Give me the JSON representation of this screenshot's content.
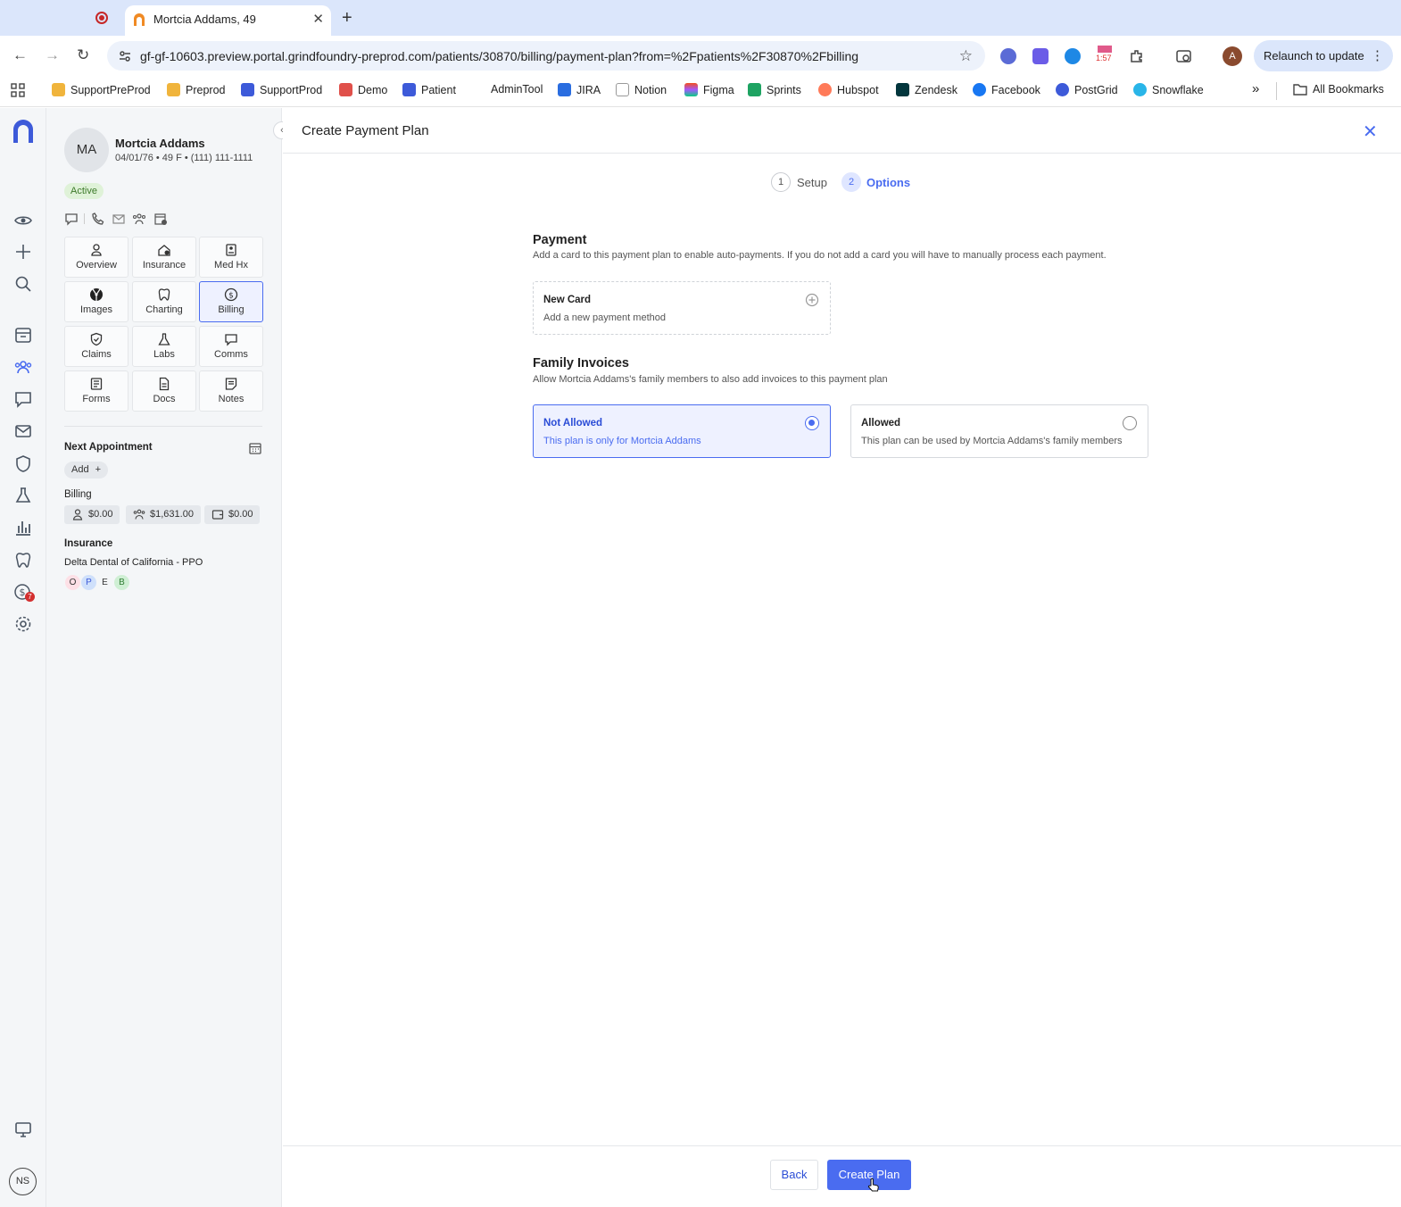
{
  "browser": {
    "tab_title": "Mortcia Addams, 49",
    "url": "gf-gf-10603.preview.portal.grindfoundry-preprod.com/patients/30870/billing/payment-plan?from=%2Fpatients%2F30870%2Fbilling",
    "relaunch_label": "Relaunch to update",
    "ext_badge": "1:57",
    "profile_initial": "A",
    "bookmarks": [
      "SupportPreProd",
      "Preprod",
      "SupportProd",
      "Demo",
      "Patient",
      "AdminTool",
      "JIRA",
      "Notion",
      "Figma",
      "Sprints",
      "Hubspot",
      "Zendesk",
      "Facebook",
      "PostGrid",
      "Snowflake"
    ],
    "all_bookmarks": "All Bookmarks",
    "overflow": "»"
  },
  "rail": {
    "user_initials": "NS",
    "notification_count": "7"
  },
  "patient": {
    "initials": "MA",
    "name": "Mortcia Addams",
    "meta": "04/01/76 • 49 F • (111) 111-1111",
    "status": "Active"
  },
  "nav_tiles": [
    "Overview",
    "Insurance",
    "Med Hx",
    "Images",
    "Charting",
    "Billing",
    "Claims",
    "Labs",
    "Comms",
    "Forms",
    "Docs",
    "Notes"
  ],
  "sidebar": {
    "next_appt_label": "Next Appointment",
    "add_label": "Add",
    "billing_label": "Billing",
    "billing_values": [
      "$0.00",
      "$1,631.00",
      "$0.00"
    ],
    "insurance_label": "Insurance",
    "insurance_name": "Delta Dental of California - PPO",
    "insurance_tags": [
      "O",
      "P",
      "E",
      "B"
    ]
  },
  "main": {
    "title": "Create Payment Plan",
    "steps": [
      {
        "num": "1",
        "label": "Setup"
      },
      {
        "num": "2",
        "label": "Options"
      }
    ],
    "payment": {
      "title": "Payment",
      "desc": "Add a card to this payment plan to enable auto-payments. If you do not add a card you will have to manually process each payment.",
      "card_title": "New Card",
      "card_sub": "Add a new payment method"
    },
    "family": {
      "title": "Family Invoices",
      "desc": "Allow Mortcia Addams's family members to also add invoices to this payment plan",
      "options": [
        {
          "title": "Not Allowed",
          "sub": "This plan is only for Mortcia Addams",
          "selected": true
        },
        {
          "title": "Allowed",
          "sub": "This plan can be used by Mortcia Addams's family members",
          "selected": false
        }
      ]
    },
    "back_label": "Back",
    "create_label": "Create Plan"
  },
  "colors": {
    "accent": "#4a6cf0",
    "active_badge": "#dff2d8"
  }
}
